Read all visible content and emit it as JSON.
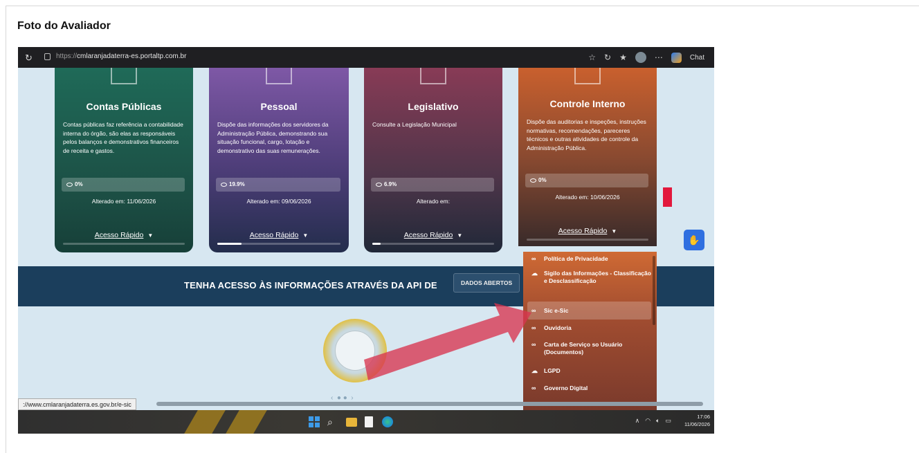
{
  "evidence_title": "Foto do Avaliador",
  "browser": {
    "url_proto": "https://",
    "url_host": "cmlaranjadaterra-es.portaltp.com.br",
    "chat_label": "Chat"
  },
  "cards": [
    {
      "title": "Contas Públicas",
      "description": "Contas públicas faz referência a contabilidade interna do órgão, são elas as responsáveis pelos balanços e demonstrativos financeiros de receita e gastos.",
      "stat": "0%",
      "changed": "Alterado em: 11/06/2026",
      "quick": "Acesso Rápido",
      "progress": 0
    },
    {
      "title": "Pessoal",
      "description": "Dispõe das informações dos servidores da Administração Pública, demonstrando sua situação funcional, cargo, lotação e demonstrativo das suas remunerações.",
      "stat": "19.9%",
      "changed": "Alterado em: 09/06/2026",
      "quick": "Acesso Rápido",
      "progress": 0.199
    },
    {
      "title": "Legislativo",
      "description": "Consulte a Legislação Municipal",
      "stat": "6.9%",
      "changed": "Alterado em:",
      "quick": "Acesso Rápido",
      "progress": 0.069
    },
    {
      "title": "Controle Interno",
      "description": "Dispõe das auditorias e inspeções, instruções normativas, recomendações, pareceres técnicos e outras atividades de controle da Administração Pública.",
      "stat": "0%",
      "changed": "Alterado em: 10/06/2026",
      "quick": "Acesso Rápido",
      "progress": 0
    }
  ],
  "dropdown": [
    {
      "icon": "link-icon",
      "label": "Política de Privacidade"
    },
    {
      "icon": "cloud-icon",
      "label": "Sigilo das Informações - Classificação e Desclassificação"
    },
    {
      "icon": "link-icon",
      "label": "Sic e-Sic"
    },
    {
      "icon": "link-icon",
      "label": "Ouvidoria"
    },
    {
      "icon": "link-icon",
      "label": "Carta de Serviço so Usuário (Documentos)"
    },
    {
      "icon": "cloud-icon",
      "label": "LGPD"
    },
    {
      "icon": "link-icon",
      "label": "Governo Digital"
    }
  ],
  "banner": {
    "text": "TENHA ACESSO ÀS INFORMAÇÕES ATRAVÉS DA API DE",
    "button": "DADOS ABERTOS"
  },
  "status_url": "://www.cmlaranjadaterra.es.gov.br/e-sic",
  "taskbar": {
    "time": "17:06",
    "date": "11/06/2026"
  },
  "colors": {
    "card_contas": "#1f6a58",
    "card_pessoal": "#7e58a6",
    "card_legislativo": "#883b56",
    "card_controle": "#c9602e",
    "annotation_red": "#e2183c",
    "banner": "#1b3e5c"
  }
}
